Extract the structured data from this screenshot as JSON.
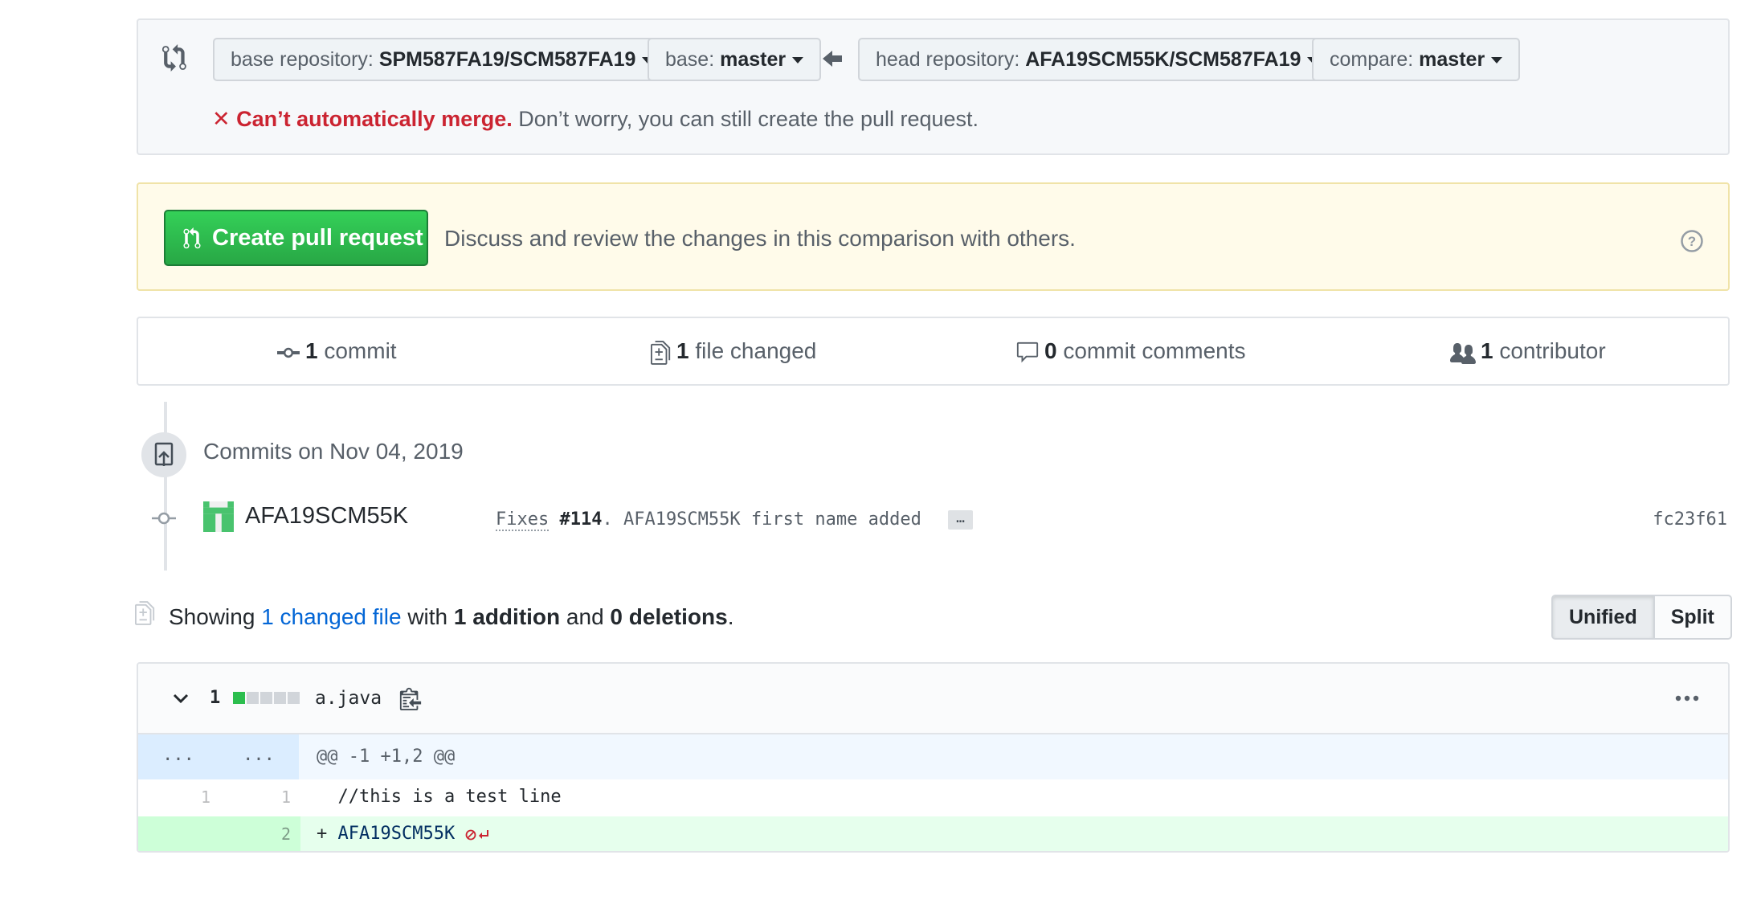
{
  "range": {
    "base_repo_label": "base repository:",
    "base_repo_value": "SPM587FA19/SCM587FA19",
    "base_label": "base:",
    "base_value": "master",
    "head_repo_label": "head repository:",
    "head_repo_value": "AFA19SCM55K/SCM587FA19",
    "compare_label": "compare:",
    "compare_value": "master",
    "merge_status": "Can’t automatically merge.",
    "merge_note": "Don’t worry, you can still create the pull request."
  },
  "create_pr": {
    "button_label": "Create pull request",
    "description": "Discuss and review the changes in this comparison with others."
  },
  "summary": {
    "commits_count": "1",
    "commits_label": "commit",
    "files_count": "1",
    "files_label": "file changed",
    "comments_count": "0",
    "comments_label": "commit comments",
    "contributors_count": "1",
    "contributors_label": "contributor"
  },
  "commits": {
    "group_title": "Commits on Nov 04, 2019",
    "items": [
      {
        "author": "AFA19SCM55K",
        "message_prefix": "Fixes",
        "issue_ref": "#114",
        "message_rest": ". AFA19SCM55K first name added",
        "ellipsis": "…",
        "sha": "fc23f61"
      }
    ]
  },
  "diff_toolbar": {
    "showing": "Showing",
    "changed_files_link": "1 changed file",
    "with": "with",
    "additions": "1 addition",
    "and": "and",
    "deletions": "0 deletions",
    "period": ".",
    "unified_label": "Unified",
    "split_label": "Split"
  },
  "file": {
    "diffstat_count": "1",
    "name": "a.java",
    "hunk_left": "...",
    "hunk_right": "...",
    "hunk_header": "@@ -1 +1,2 @@",
    "lines": [
      {
        "old": "1",
        "new": "1",
        "text": "  //this is a test line"
      },
      {
        "old": "",
        "new": "2",
        "marker": "+ ",
        "text": "AFA19SCM55K"
      }
    ]
  },
  "colors": {
    "add_green": "#2cbe4e",
    "error_red": "#cb2431",
    "link_blue": "#0366d6"
  }
}
